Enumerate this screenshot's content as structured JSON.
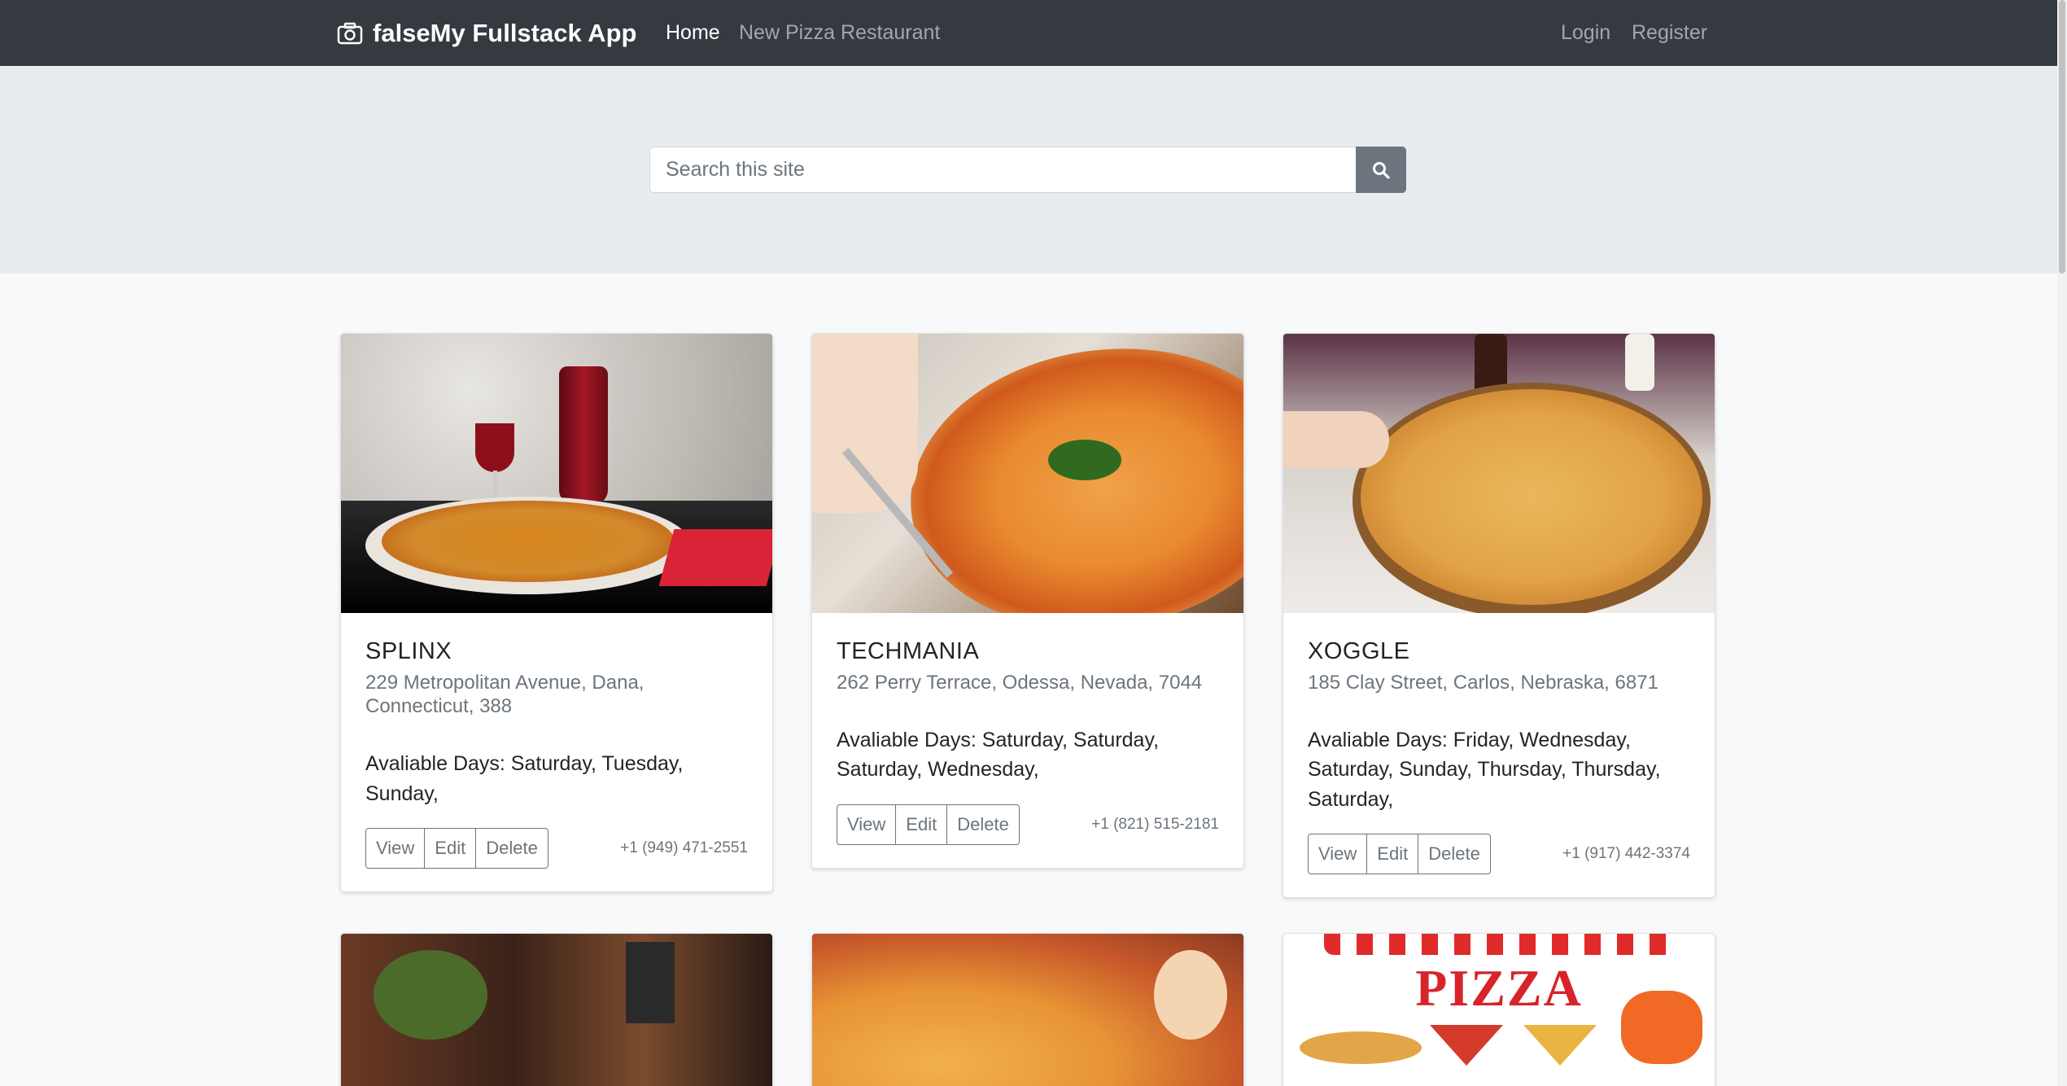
{
  "navbar": {
    "brand_icon": "camera-icon",
    "brand": "falseMy Fullstack App",
    "links": {
      "home": "Home",
      "new_restaurant": "New Pizza Restaurant"
    },
    "auth": {
      "login": "Login",
      "register": "Register"
    }
  },
  "search": {
    "placeholder": "Search this site",
    "button_icon": "search-icon"
  },
  "cards": [
    {
      "title": "SPLINX",
      "address": "229 Metropolitan Avenue, Dana, Connecticut, 388",
      "days": "Avaliable Days: Saturday, Tuesday, Sunday,",
      "phone": "+1 (949) 471-2551",
      "buttons": {
        "view": "View",
        "edit": "Edit",
        "delete": "Delete"
      }
    },
    {
      "title": "TECHMANIA",
      "address": "262 Perry Terrace, Odessa, Nevada, 7044",
      "days": "Avaliable Days: Saturday, Saturday, Saturday, Wednesday,",
      "phone": "+1 (821) 515-2181",
      "buttons": {
        "view": "View",
        "edit": "Edit",
        "delete": "Delete"
      }
    },
    {
      "title": "XOGGLE",
      "address": "185 Clay Street, Carlos, Nebraska, 6871",
      "days": "Avaliable Days: Friday, Wednesday, Saturday, Sunday, Thursday, Thursday, Saturday,",
      "phone": "+1 (917) 442-3374",
      "buttons": {
        "view": "View",
        "edit": "Edit",
        "delete": "Delete"
      }
    }
  ],
  "partial_cards": {
    "card6_image_text": "PIZZA"
  },
  "colors": {
    "navbar_bg": "#343a40",
    "hero_bg": "#e9ecef",
    "page_bg": "#f8f9fa",
    "secondary": "#6c757d"
  }
}
